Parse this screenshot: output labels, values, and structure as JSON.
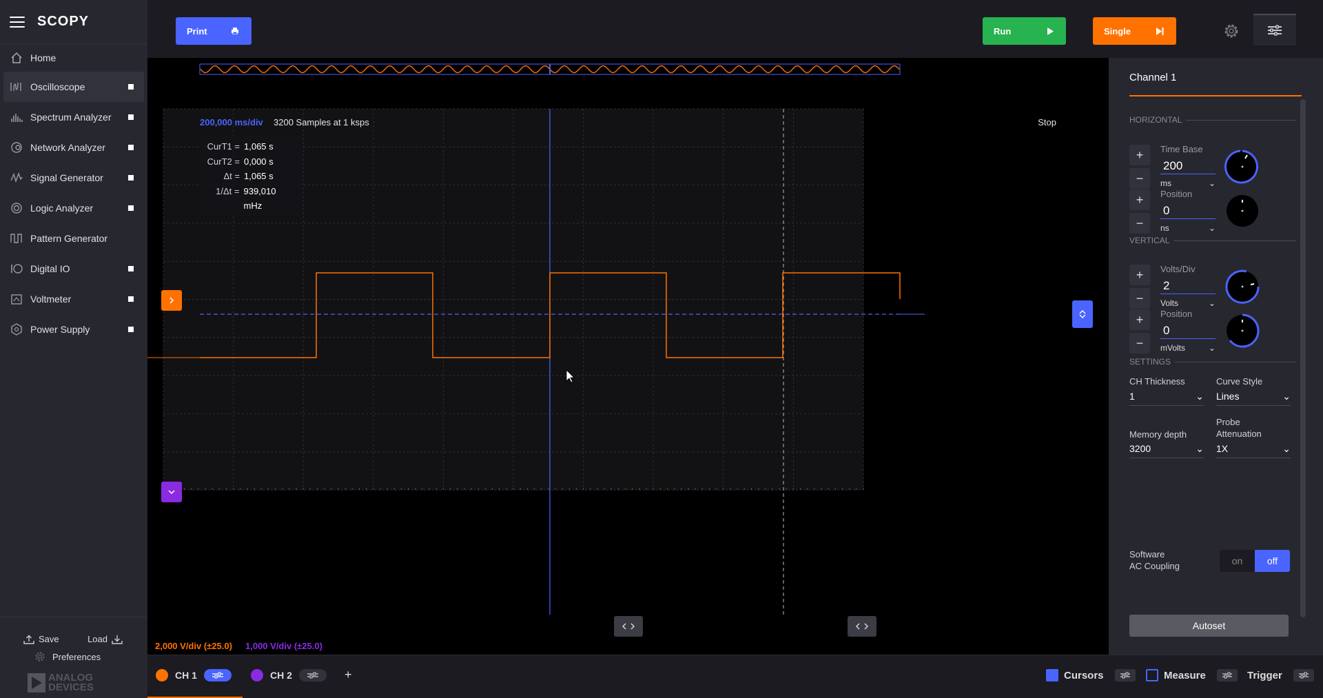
{
  "app": {
    "logo": "SCOPY",
    "brand": "ANALOG DEVICES",
    "brand_line1": "ANALOG",
    "brand_line2": "DEVICES"
  },
  "sidebar": {
    "home": "Home",
    "items": [
      {
        "label": "Oscilloscope",
        "icon": "oscilloscope-icon",
        "active": true
      },
      {
        "label": "Spectrum Analyzer",
        "icon": "spectrum-icon"
      },
      {
        "label": "Network Analyzer",
        "icon": "network-icon"
      },
      {
        "label": "Signal Generator",
        "icon": "signal-icon"
      },
      {
        "label": "Logic Analyzer",
        "icon": "logic-icon"
      },
      {
        "label": "Pattern Generator",
        "icon": "pattern-icon"
      },
      {
        "label": "Digital IO",
        "icon": "digital-io-icon"
      },
      {
        "label": "Voltmeter",
        "icon": "voltmeter-icon"
      },
      {
        "label": "Power Supply",
        "icon": "power-icon"
      }
    ],
    "save": "Save",
    "load": "Load",
    "preferences": "Preferences"
  },
  "toolbar": {
    "print": "Print",
    "run": "Run",
    "single": "Single"
  },
  "plot": {
    "time_div": "200,000 ms/div",
    "samples": "3200 Samples at 1 ksps",
    "status": "Stop",
    "cursors": [
      {
        "k": "CurT1 =",
        "v": "1,065 s"
      },
      {
        "k": "CurT2 =",
        "v": "0,000 s"
      },
      {
        "k": "Δt =",
        "v": "1,065 s"
      },
      {
        "k": "1/Δt =",
        "v": "939,010 mHz"
      }
    ],
    "ch1_vdiv": "2,000 V/div (±25.0)",
    "ch2_vdiv": "1,000 V/div (±25.0)",
    "colors": {
      "ch1": "#ff7200",
      "ch2": "#8a2be2",
      "accent": "#4a64ff"
    }
  },
  "panel": {
    "title": "Channel 1",
    "horizontal": "HORIZONTAL",
    "vertical": "VERTICAL",
    "settings": "SETTINGS",
    "timebase": {
      "label": "Time Base",
      "value": "200",
      "unit": "ms"
    },
    "hpos": {
      "label": "Position",
      "value": "0",
      "unit": "ns"
    },
    "voltsdiv": {
      "label": "Volts/Div",
      "value": "2",
      "unit": "Volts"
    },
    "vpos": {
      "label": "Position",
      "value": "0",
      "unit": "mVolts"
    },
    "thickness": {
      "label": "CH Thickness",
      "value": "1"
    },
    "curve": {
      "label": "Curve Style",
      "value": "Lines"
    },
    "memory": {
      "label": "Memory depth",
      "value": "3200"
    },
    "probe": {
      "label1": "Probe",
      "label2": "Attenuation",
      "value": "1X"
    },
    "ac": {
      "label1": "Software",
      "label2": "AC Coupling",
      "on": "on",
      "off": "off"
    },
    "autoset": "Autoset"
  },
  "bottom": {
    "ch1": "CH 1",
    "ch2": "CH 2",
    "add": "+",
    "cursors": "Cursors",
    "measure": "Measure",
    "trigger": "Trigger"
  }
}
